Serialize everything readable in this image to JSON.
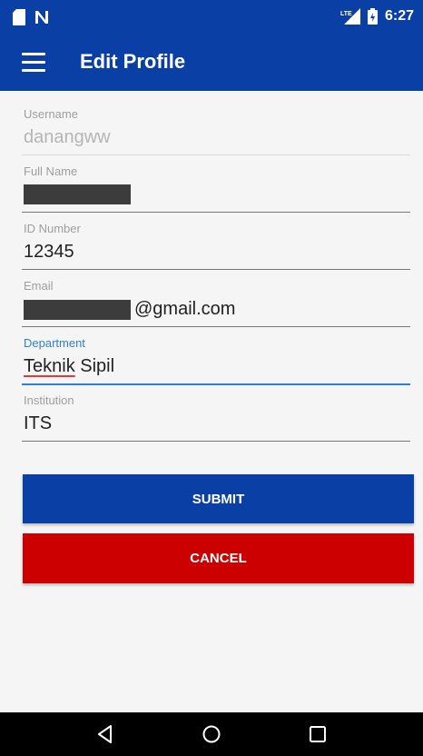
{
  "status_bar": {
    "time": "6:27",
    "icons": [
      "sd-card-icon",
      "n-notification-icon",
      "lte-signal-icon",
      "battery-icon"
    ],
    "network": "LTE"
  },
  "toolbar": {
    "title": "Edit Profile",
    "menu_icon": "hamburger-menu-icon"
  },
  "form": {
    "fields": [
      {
        "label": "Username",
        "value": "danangww"
      },
      {
        "label": "Full Name",
        "value": ""
      },
      {
        "label": "ID Number",
        "value": "12345"
      },
      {
        "label": "Email",
        "value": "@gmail.com"
      },
      {
        "label": "Department",
        "value_part1": "Teknik",
        "value_part2": " Sipil"
      },
      {
        "label": "Institution",
        "value": "ITS"
      }
    ]
  },
  "buttons": {
    "submit_label": "SUBMIT",
    "cancel_label": "CANCEL"
  },
  "colors": {
    "primary": "#0a3fa6",
    "cancel": "#cc0000",
    "focus": "#2f7ed8"
  },
  "nav_bar": {
    "icons": [
      "back-icon",
      "home-icon",
      "recents-icon"
    ]
  }
}
